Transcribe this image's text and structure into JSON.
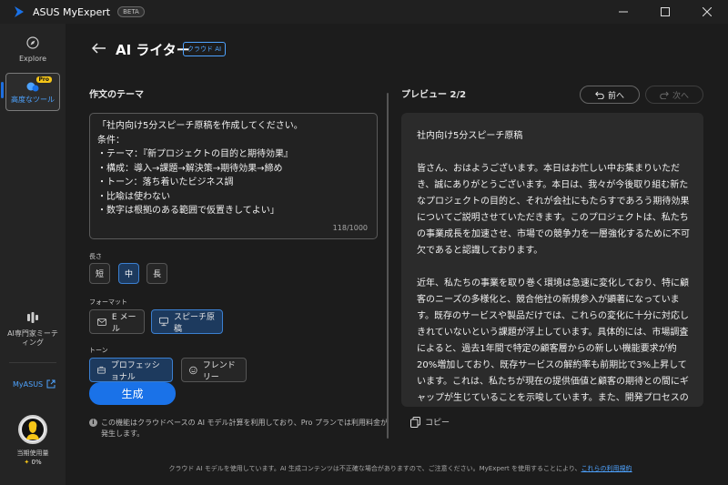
{
  "titlebar": {
    "app_title": "ASUS MyExpert",
    "beta": "BETA"
  },
  "sidebar": {
    "explore": "Explore",
    "advanced_tools": "高度なツール",
    "pro_badge": "Pro",
    "meeting": "AI専門家ミーティング",
    "myasus": "MyASUS",
    "usage_label": "当期使用量",
    "usage_value": "0%"
  },
  "header": {
    "title": "AI ライター",
    "badge": "クラウド AI"
  },
  "topic": {
    "label": "作文のテーマ",
    "text": "「社内向け5分スピーチ原稿を作成してください。\n条件：\n・テーマ：『新プロジェクトの目的と期待効果』\n・構成：導入→課題→解決策→期待効果→締め\n・トーン：落ち着いたビジネス調\n・比喩は使わない\n・数字は根拠のある範囲で仮置きしてよい」",
    "counter": "118/1000"
  },
  "length": {
    "label": "長さ",
    "options": [
      "短",
      "中",
      "長"
    ],
    "selected": "中"
  },
  "format": {
    "label": "フォーマット",
    "email": "E メール",
    "speech": "スピーチ原稿",
    "selected": "スピーチ原稿"
  },
  "tone": {
    "label": "トーン",
    "professional": "プロフェッショナル",
    "friendly": "フレンドリー",
    "selected": "プロフェッショナル"
  },
  "generate_button": "生成",
  "notice": "この機能はクラウドベースの AI モデル計算を利用しており、Pro プランでは利用料金が発生します。",
  "preview": {
    "label": "プレビュー 2/2",
    "prev": "前へ",
    "next": "次へ",
    "title": "社内向け5分スピーチ原稿",
    "para1": "皆さん、おはようございます。本日はお忙しい中お集まりいただき、誠にありがとうございます。本日は、我々が今後取り組む新たなプロジェクトの目的と、それが会社にもたらすであろう期待効果についてご説明させていただきます。このプロジェクトは、私たちの事業成長を加速させ、市場での競争力を一層強化するために不可欠であると認識しております。",
    "para2": "近年、私たちの事業を取り巻く環境は急速に変化しており、特に顧客のニーズの多様化と、競合他社の新規参入が顕著になっています。既存のサービスや製品だけでは、これらの変化に十分に対応しきれていないという課題が浮上しています。具体的には、市場調査によると、過去1年間で特定の顧客層からの新しい機能要求が約20%増加しており、既存サービスの解約率も前期比で3%上昇しています。これは、私たちが現在の提供価値と顧客の期待との間にギャップが生じていることを示唆しています。また、開発プロセスの非効率性も看過できない課題で",
    "copy": "コピー"
  },
  "footer": {
    "text": "クラウド AI モデルを使用しています。AI 生成コンテンツは不正確な場合がありますので、ご注意ください。MyExpert を使用することにより、",
    "link": "これらの利用規約"
  }
}
